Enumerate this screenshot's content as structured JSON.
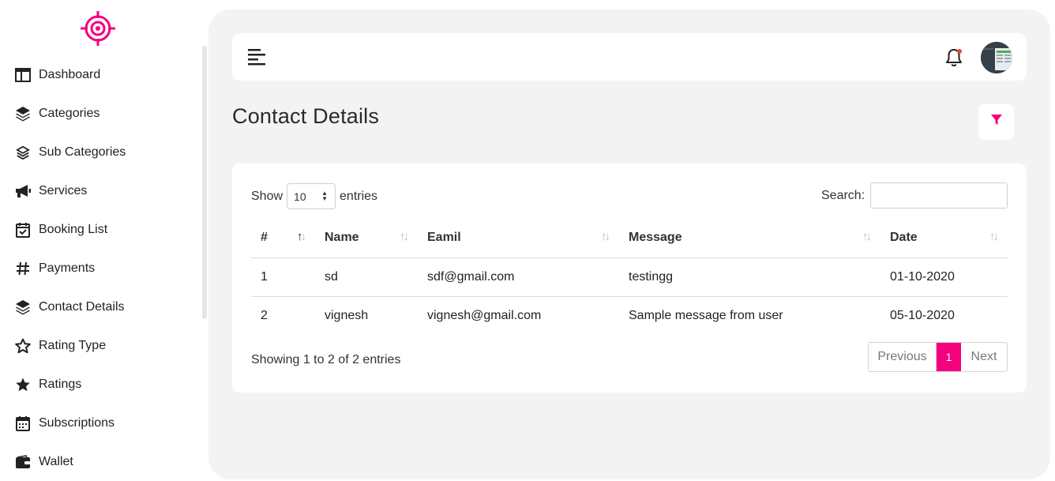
{
  "sidebar": {
    "items": [
      {
        "label": "Dashboard",
        "icon": "dashboard-icon"
      },
      {
        "label": "Categories",
        "icon": "layers-icon"
      },
      {
        "label": "Sub Categories",
        "icon": "layers-outline-icon"
      },
      {
        "label": "Services",
        "icon": "megaphone-icon"
      },
      {
        "label": "Booking List",
        "icon": "calendar-check-icon"
      },
      {
        "label": "Payments",
        "icon": "hash-icon"
      },
      {
        "label": "Contact Details",
        "icon": "layers-icon"
      },
      {
        "label": "Rating Type",
        "icon": "star-outline-icon"
      },
      {
        "label": "Ratings",
        "icon": "star-icon"
      },
      {
        "label": "Subscriptions",
        "icon": "calendar-icon"
      },
      {
        "label": "Wallet",
        "icon": "wallet-icon"
      }
    ]
  },
  "page": {
    "title": "Contact Details"
  },
  "table_controls": {
    "show_label": "Show",
    "entries_value": "10",
    "entries_label": "entries",
    "search_label": "Search:",
    "search_value": ""
  },
  "table": {
    "headers": [
      "#",
      "Name",
      "Eamil",
      "Message",
      "Date"
    ],
    "rows": [
      [
        "1",
        "sd",
        "sdf@gmail.com",
        "testingg",
        "01-10-2020"
      ],
      [
        "2",
        "vignesh",
        "vignesh@gmail.com",
        "Sample message from user",
        "05-10-2020"
      ]
    ]
  },
  "footer": {
    "info": "Showing 1 to 2 of 2 entries",
    "previous": "Previous",
    "current_page": "1",
    "next": "Next"
  },
  "colors": {
    "accent": "#f5007f",
    "background": "#f3f3f3"
  }
}
